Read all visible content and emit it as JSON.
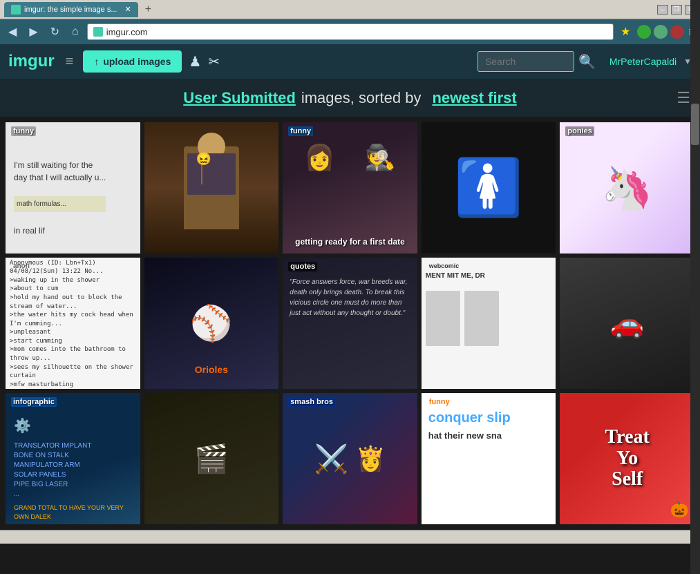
{
  "window": {
    "title": "imgur: the simple image s...",
    "close_label": "✕",
    "restore_label": "❐",
    "minimize_label": "─"
  },
  "nav": {
    "url": "imgur.com",
    "back_label": "◀",
    "forward_label": "▶",
    "reload_label": "↻",
    "home_label": "⌂",
    "star_label": "★",
    "menu_label": "≡"
  },
  "imgur_bar": {
    "logo": "imgur",
    "hamburger_label": "≡",
    "upload_label": "upload images",
    "upload_icon": "↑",
    "nav_icon1": "♟",
    "nav_icon2": "✂",
    "search_placeholder": "Search",
    "search_label": "Search",
    "search_icon": "🔍",
    "user_name": "MrPeterCapaldi",
    "user_arrow": "▼"
  },
  "hero": {
    "link_text": "User Submitted",
    "plain_text": " images, sorted by ",
    "sorted_text": "",
    "newest_text": "newest first",
    "list_icon": "☰"
  },
  "gallery": {
    "items": [
      {
        "id": 1,
        "tag": "funny",
        "text": "I'm still waiting for the\nday that I will actually u...\n\nin real lif",
        "bg": "bg-lightgray",
        "has_text": true
      },
      {
        "id": 2,
        "tag": "",
        "text": "",
        "bg": "bg-brown",
        "has_text": false,
        "description": "Man in suit looking distressed"
      },
      {
        "id": 3,
        "tag": "funny",
        "text": "getting ready for a first date",
        "bg": "bg-teal",
        "has_text": true
      },
      {
        "id": 4,
        "tag": "",
        "text": "",
        "bg": "bg-black",
        "has_text": false,
        "description": "Silhouette figure"
      },
      {
        "id": 5,
        "tag": "ponies",
        "text": "",
        "bg": "bg-pinkish",
        "has_text": false,
        "description": "My Little Pony characters"
      },
      {
        "id": 6,
        "tag": "anon",
        "text": "Anonymous greentext story about shower",
        "bg": "bg-white",
        "has_text": true
      },
      {
        "id": 7,
        "tag": "",
        "text": "",
        "bg": "bg-darkgray",
        "has_text": false,
        "description": "Baseball players Orioles"
      },
      {
        "id": 8,
        "tag": "quotes",
        "text": "\"Force answers force, war breeds war, death only brings death. To break this vicious circle one must do more than just act without any thought or doubt.\"",
        "bg": "bg-darkblue",
        "has_text": true
      },
      {
        "id": 9,
        "tag": "webcomic",
        "text": "MENT MIT ME, DR",
        "bg": "bg-white",
        "has_text": true
      },
      {
        "id": 10,
        "tag": "",
        "text": "",
        "bg": "bg-darkgray",
        "has_text": false,
        "description": "Car with rope trick"
      },
      {
        "id": 11,
        "tag": "infographic",
        "text": "infographic",
        "bg": "bg-infographic",
        "has_text": true
      },
      {
        "id": 12,
        "tag": "",
        "text": "",
        "bg": "bg-oldmovie",
        "has_text": false,
        "description": "Old movie scene"
      },
      {
        "id": 13,
        "tag": "smash bros",
        "text": "smash bros",
        "bg": "bg-smashbros",
        "has_text": true
      },
      {
        "id": 14,
        "tag": "funny",
        "text": "conquer slip\n\nhat their new sna",
        "bg": "bg-white",
        "has_text": true,
        "text_color": "black"
      },
      {
        "id": 15,
        "tag": "",
        "text": "Treat\nYo\nSelf",
        "bg": "bg-treatyoself",
        "has_text": true
      }
    ]
  },
  "status_bar": {
    "text": ""
  }
}
